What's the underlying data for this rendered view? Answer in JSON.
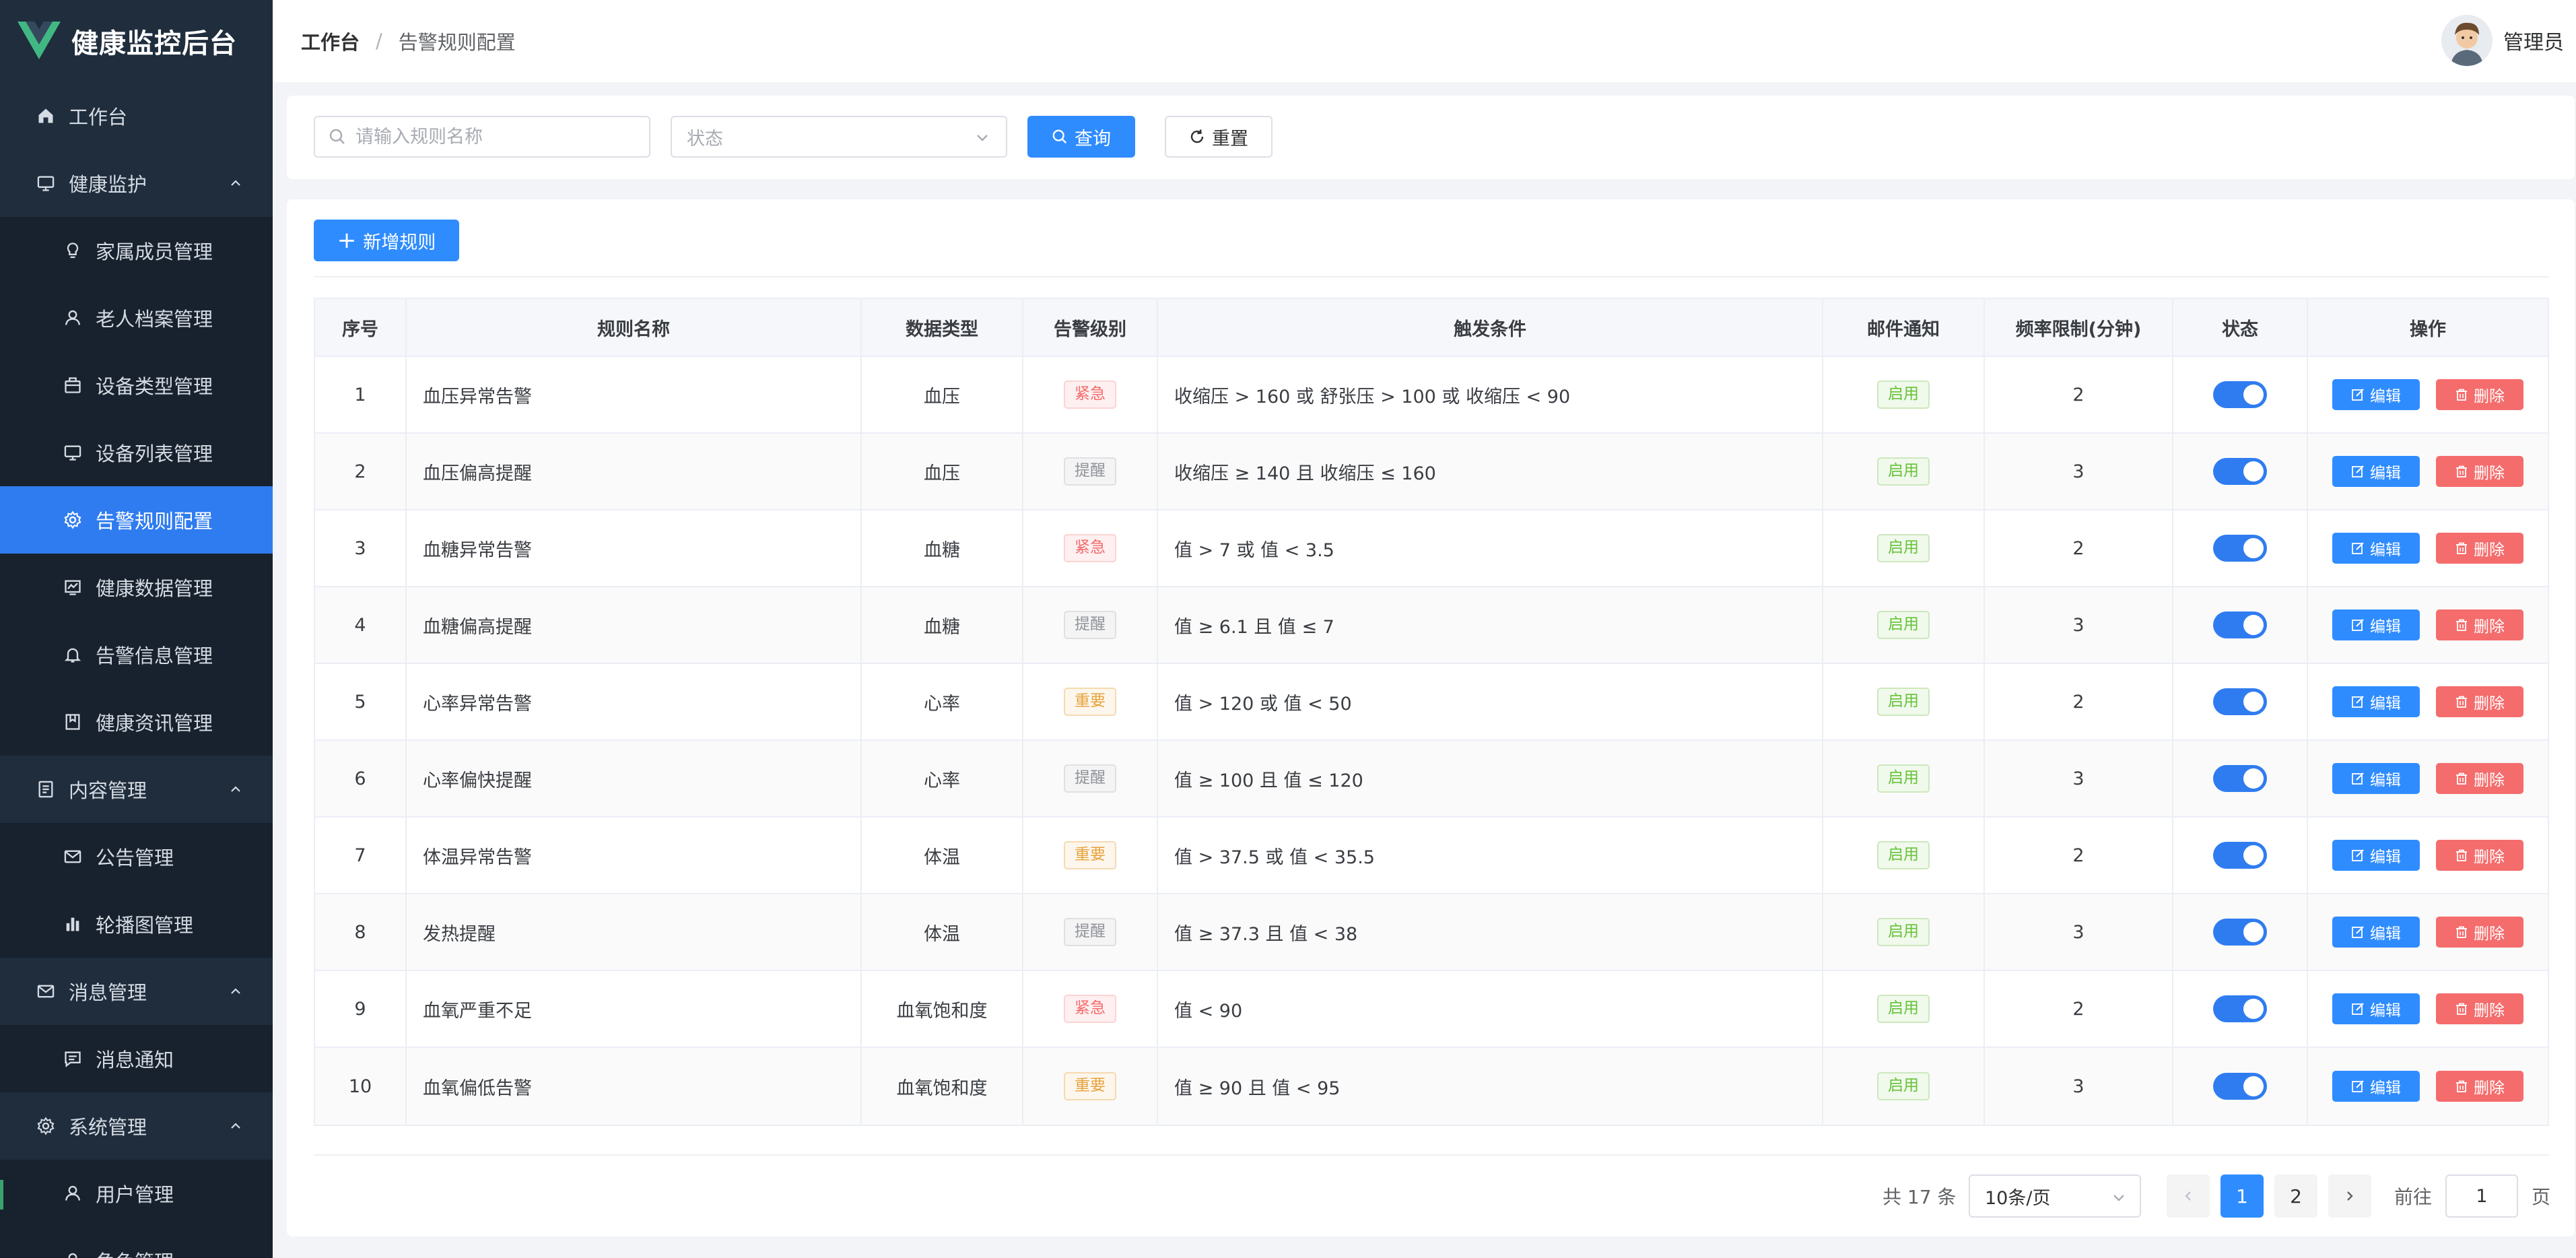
{
  "app": {
    "title": "健康监控后台"
  },
  "header": {
    "breadcrumb": {
      "home": "工作台",
      "separator": "/",
      "current": "告警规则配置"
    },
    "user": {
      "name": "管理员"
    }
  },
  "sidebar": {
    "items": [
      {
        "label": "工作台",
        "icon": "home-icon",
        "type": "top"
      },
      {
        "label": "健康监护",
        "icon": "monitor-icon",
        "type": "group"
      },
      {
        "label": "家属成员管理",
        "icon": "bulb-icon",
        "type": "sub"
      },
      {
        "label": "老人档案管理",
        "icon": "user-icon",
        "type": "sub"
      },
      {
        "label": "设备类型管理",
        "icon": "box-icon",
        "type": "sub"
      },
      {
        "label": "设备列表管理",
        "icon": "monitor-icon",
        "type": "sub"
      },
      {
        "label": "告警规则配置",
        "icon": "gear-icon",
        "type": "sub",
        "active": true
      },
      {
        "label": "健康数据管理",
        "icon": "chart-icon",
        "type": "sub"
      },
      {
        "label": "告警信息管理",
        "icon": "bell-icon",
        "type": "sub"
      },
      {
        "label": "健康资讯管理",
        "icon": "bookmark-icon",
        "type": "sub"
      },
      {
        "label": "内容管理",
        "icon": "document-icon",
        "type": "group"
      },
      {
        "label": "公告管理",
        "icon": "mail-icon",
        "type": "sub"
      },
      {
        "label": "轮播图管理",
        "icon": "bar-chart-icon",
        "type": "sub"
      },
      {
        "label": "消息管理",
        "icon": "mail-icon",
        "type": "group"
      },
      {
        "label": "消息通知",
        "icon": "message-icon",
        "type": "sub"
      },
      {
        "label": "系统管理",
        "icon": "gear-icon",
        "type": "group"
      },
      {
        "label": "用户管理",
        "icon": "user-icon",
        "type": "sub"
      },
      {
        "label": "角色管理",
        "icon": "user-icon",
        "type": "sub"
      }
    ]
  },
  "search": {
    "name_placeholder": "请输入规则名称",
    "status_placeholder": "状态",
    "query_label": "查询",
    "reset_label": "重置"
  },
  "toolbar": {
    "add_label": "新增规则"
  },
  "table": {
    "columns": [
      "序号",
      "规则名称",
      "数据类型",
      "告警级别",
      "触发条件",
      "邮件通知",
      "频率限制(分钟)",
      "状态",
      "操作"
    ],
    "edit_label": "编辑",
    "delete_label": "删除",
    "rows": [
      {
        "index": "1",
        "name": "血压异常告警",
        "data_type": "血压",
        "level": "紧急",
        "level_color": "#f56c6c",
        "condition": "收缩压 > 160 或 舒张压 > 100 或 收缩压 < 90",
        "email": "启用",
        "freq": "2",
        "enabled": true
      },
      {
        "index": "2",
        "name": "血压偏高提醒",
        "data_type": "血压",
        "level": "提醒",
        "level_color": "#909399",
        "condition": "收缩压 ≥ 140 且 收缩压 ≤ 160",
        "email": "启用",
        "freq": "3",
        "enabled": true
      },
      {
        "index": "3",
        "name": "血糖异常告警",
        "data_type": "血糖",
        "level": "紧急",
        "level_color": "#f56c6c",
        "condition": "值 > 7 或 值 < 3.5",
        "email": "启用",
        "freq": "2",
        "enabled": true
      },
      {
        "index": "4",
        "name": "血糖偏高提醒",
        "data_type": "血糖",
        "level": "提醒",
        "level_color": "#909399",
        "condition": "值 ≥ 6.1 且 值 ≤ 7",
        "email": "启用",
        "freq": "3",
        "enabled": true
      },
      {
        "index": "5",
        "name": "心率异常告警",
        "data_type": "心率",
        "level": "重要",
        "level_color": "#e6a23c",
        "condition": "值 > 120 或 值 < 50",
        "email": "启用",
        "freq": "2",
        "enabled": true
      },
      {
        "index": "6",
        "name": "心率偏快提醒",
        "data_type": "心率",
        "level": "提醒",
        "level_color": "#909399",
        "condition": "值 ≥ 100 且 值 ≤ 120",
        "email": "启用",
        "freq": "3",
        "enabled": true
      },
      {
        "index": "7",
        "name": "体温异常告警",
        "data_type": "体温",
        "level": "重要",
        "level_color": "#e6a23c",
        "condition": "值 > 37.5 或 值 < 35.5",
        "email": "启用",
        "freq": "2",
        "enabled": true
      },
      {
        "index": "8",
        "name": "发热提醒",
        "data_type": "体温",
        "level": "提醒",
        "level_color": "#909399",
        "condition": "值 ≥ 37.3 且 值 < 38",
        "email": "启用",
        "freq": "3",
        "enabled": true
      },
      {
        "index": "9",
        "name": "血氧严重不足",
        "data_type": "血氧饱和度",
        "level": "紧急",
        "level_color": "#f56c6c",
        "condition": "值 < 90",
        "email": "启用",
        "freq": "2",
        "enabled": true
      },
      {
        "index": "10",
        "name": "血氧偏低告警",
        "data_type": "血氧饱和度",
        "level": "重要",
        "level_color": "#e6a23c",
        "condition": "值 ≥ 90 且 值 < 95",
        "email": "启用",
        "freq": "3",
        "enabled": true
      }
    ]
  },
  "pagination": {
    "total_text": "共 17 条",
    "page_size": "10条/页",
    "pages": [
      "1",
      "2"
    ],
    "current_page": "1",
    "goto_label": "前往",
    "goto_value": "1",
    "goto_unit": "页"
  },
  "colors": {
    "sidebar_bg": "#1f2d3d",
    "accent": "#2f8cff",
    "danger": "#f56c6c",
    "success": "#67c23a",
    "warning": "#e6a23c"
  }
}
